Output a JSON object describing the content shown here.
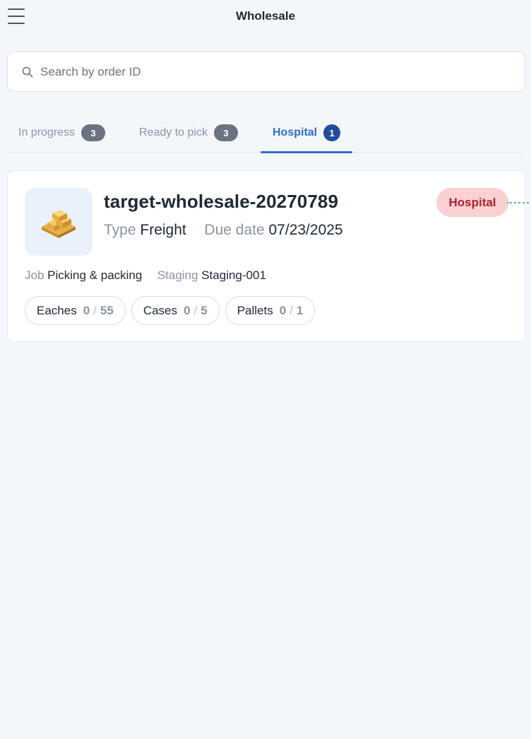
{
  "header": {
    "title": "Wholesale",
    "menu_icon": "hamburger-menu-icon"
  },
  "search": {
    "placeholder": "Search by order ID",
    "value": "",
    "icon": "search-icon"
  },
  "tabs": [
    {
      "label": "In progress",
      "count": "3",
      "active": false
    },
    {
      "label": "Ready to pick",
      "count": "3",
      "active": false
    },
    {
      "label": "Hospital",
      "count": "1",
      "active": true
    }
  ],
  "order": {
    "id": "target-wholesale-20270789",
    "type_label": "Type",
    "type_value": "Freight",
    "due_label": "Due date",
    "due_value": "07/23/2025",
    "status": "Hospital",
    "job_label": "Job",
    "job_value": "Picking & packing",
    "staging_label": "Staging",
    "staging_value": "Staging-001",
    "thumbnail_icon": "pallet-boxes-icon",
    "counts": [
      {
        "label": "Eaches",
        "done": "0",
        "sep": "/",
        "total": "55"
      },
      {
        "label": "Cases",
        "done": "0",
        "sep": "/",
        "total": "5"
      },
      {
        "label": "Pallets",
        "done": "0",
        "sep": "/",
        "total": "1"
      }
    ]
  },
  "colors": {
    "accent": "#2f6fd1",
    "status_bg": "#fbd0d3",
    "status_text": "#b3202f",
    "background": "#f4f7fa"
  }
}
